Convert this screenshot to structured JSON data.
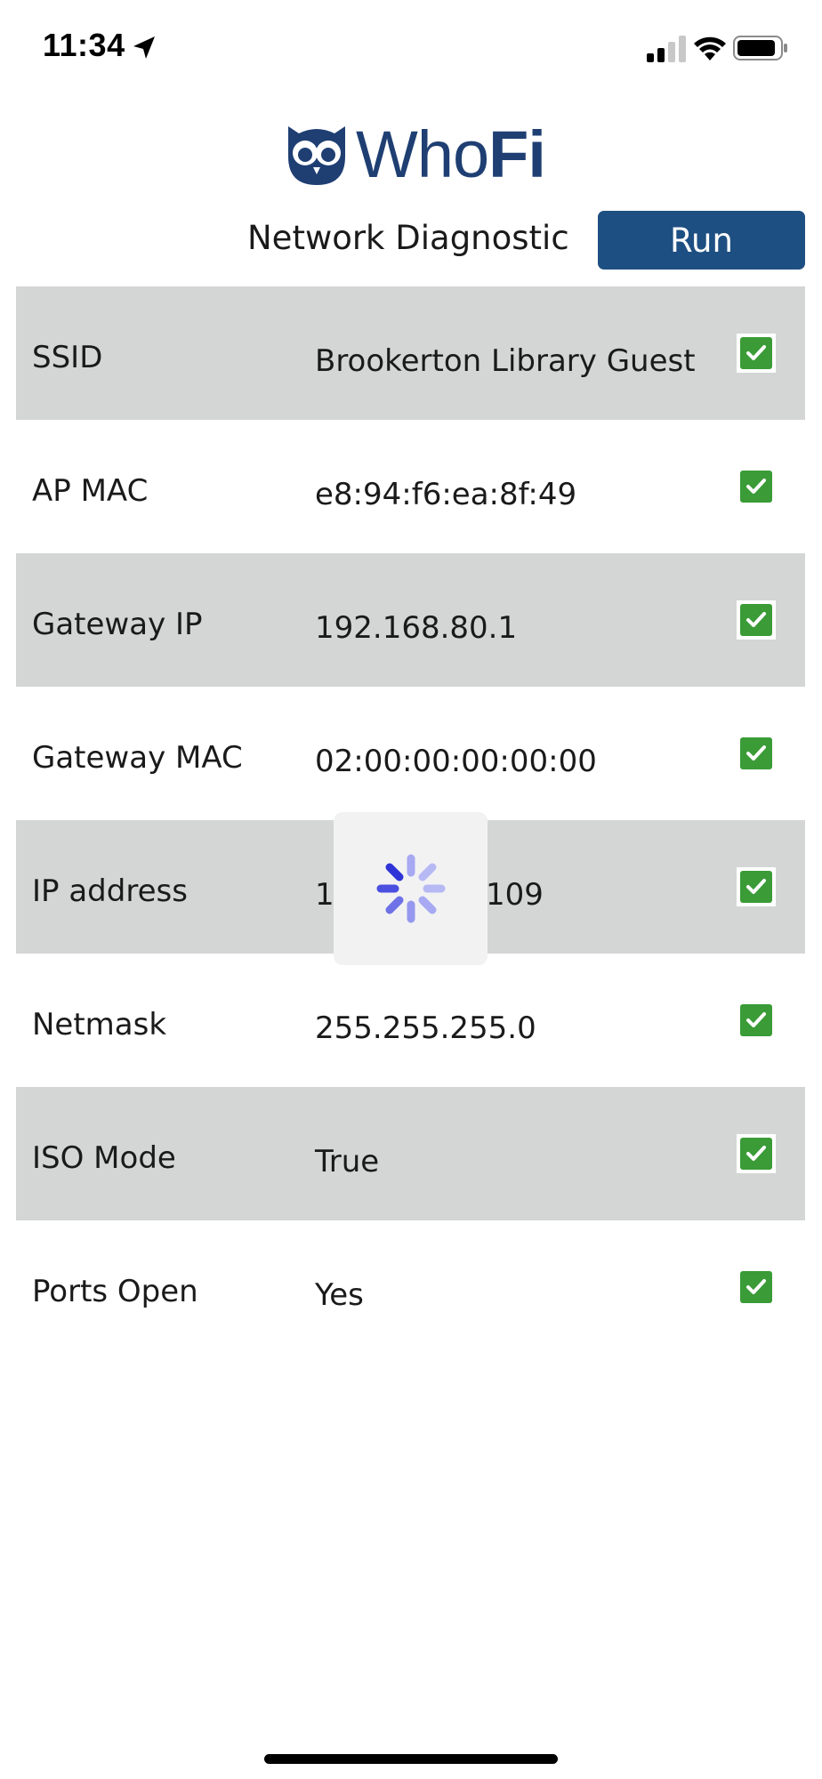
{
  "status_bar": {
    "time": "11:34",
    "icons": [
      "location-arrow-icon",
      "cellular-signal-icon",
      "wifi-icon",
      "battery-icon"
    ]
  },
  "logo": {
    "text_who": "Who",
    "text_fi": "Fi",
    "icon": "owl-icon",
    "color": "#1f3f73"
  },
  "header": {
    "title": "Network Diagnostic",
    "run_label": "Run",
    "run_color": "#1e4f82"
  },
  "rows": [
    {
      "label": "SSID",
      "value": "Brookerton Library Guest",
      "status": "checked"
    },
    {
      "label": "AP MAC",
      "value": "e8:94:f6:ea:8f:49",
      "status": "checked"
    },
    {
      "label": "Gateway IP",
      "value": "192.168.80.1",
      "status": "checked"
    },
    {
      "label": "Gateway MAC",
      "value": "02:00:00:00:00:00",
      "status": "checked"
    },
    {
      "label": "IP address",
      "value": "1",
      "value_tail": "109",
      "status": "checked"
    },
    {
      "label": "Netmask",
      "value": "255.255.255.0",
      "status": "checked"
    },
    {
      "label": "ISO Mode",
      "value": "True",
      "status": "checked"
    },
    {
      "label": "Ports Open",
      "value": "Yes",
      "status": "checked"
    }
  ],
  "colors": {
    "row_shade": "#d4d6d6",
    "check_green": "#3a9b37",
    "spinner": "#4a4fe0"
  },
  "loading": {
    "icon": "spinner-icon",
    "visible": true
  }
}
